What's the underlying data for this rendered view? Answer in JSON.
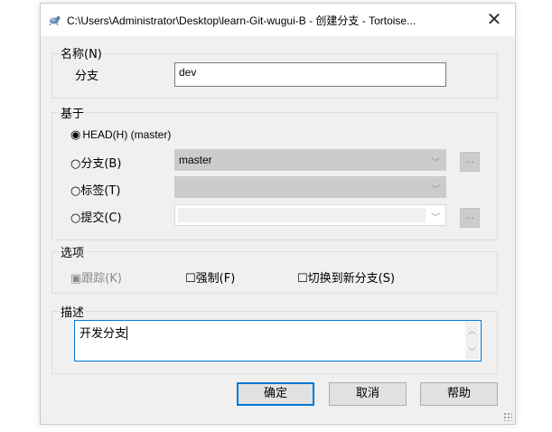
{
  "window": {
    "title": "C:\\Users\\Administrator\\Desktop\\learn-Git-wugui-B - 创建分支 - Tortoise...",
    "close_glyph": "✕"
  },
  "name_group": {
    "legend": "名称(N)",
    "branch_label": "分支",
    "branch_value": "dev"
  },
  "base_group": {
    "legend": "基于",
    "head_option": "HEAD(H) (master)",
    "branch_option": "分支(B)",
    "branch_combo_value": "master",
    "tag_option": "标签(T)",
    "commit_option": "提交(C)",
    "dots": "...",
    "selected": "head"
  },
  "options_group": {
    "legend": "选项",
    "track_label": "跟踪(K)",
    "track_checked": true,
    "track_enabled": false,
    "force_label": "强制(F)",
    "force_checked": false,
    "switch_label": "切换到新分支(S)",
    "switch_checked": false
  },
  "desc_group": {
    "legend": "描述",
    "text": "开发分支"
  },
  "buttons": {
    "ok": "确定",
    "cancel": "取消",
    "help": "帮助"
  },
  "colors": {
    "accent": "#0078d7",
    "dialog_bg": "#f0f0f0",
    "disabled_combo": "#cccccc"
  }
}
